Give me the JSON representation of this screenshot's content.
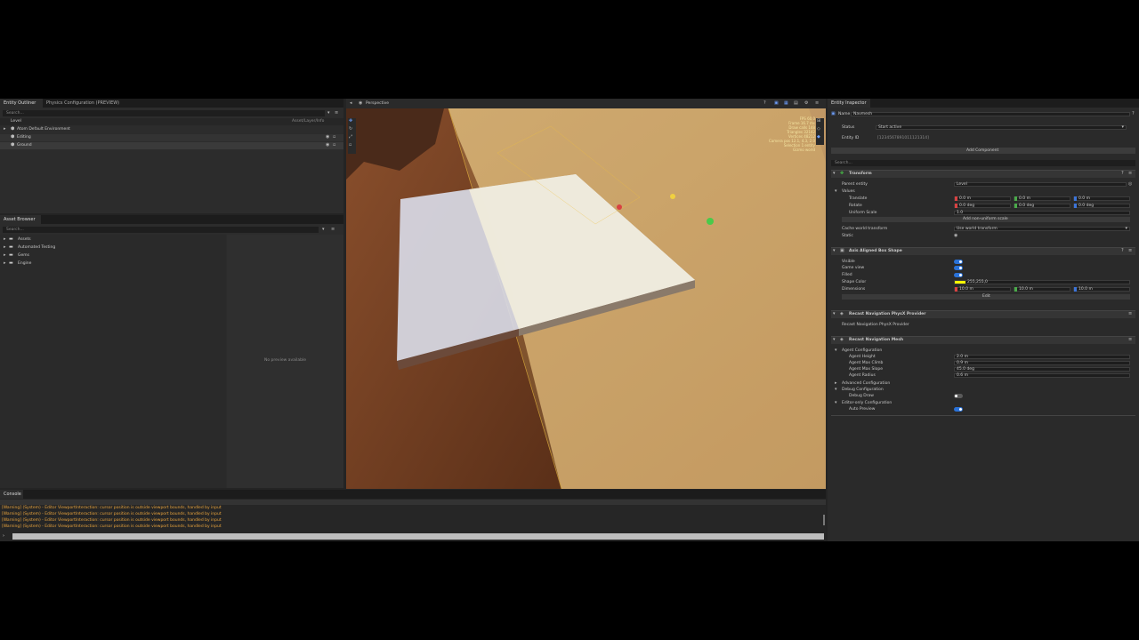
{
  "hierarchy": {
    "tabs": [
      "Entity Outliner",
      "Physics Configuration (PREVIEW)"
    ],
    "search_placeholder": "Search...",
    "column_label": "Level",
    "column_right": "Asset/Layer/Info",
    "items": [
      {
        "label": "Atom Default Environment"
      },
      {
        "label": "Editing"
      },
      {
        "label": "Ground"
      }
    ]
  },
  "asset_browser": {
    "tab": "Asset Browser",
    "search_placeholder": "Search...",
    "folders": [
      {
        "label": "Assets"
      },
      {
        "label": "Automated Testing"
      },
      {
        "label": "Gems"
      },
      {
        "label": "Engine"
      }
    ],
    "preview_text": "No preview available"
  },
  "viewport": {
    "tab": "Perspective",
    "stats": [
      "FPS 60.0",
      "Frame 16.7 ms",
      "Draw calls 148",
      "Triangles 32142",
      "Vertices 48212",
      "Camera pos 12.1, 4.3, 2.0",
      "Selection 1 entity",
      "Gizmo world"
    ]
  },
  "console": {
    "tab": "Console",
    "lines": [
      "[Warning] (System) - Editor ViewportInteraction: cursor position is outside viewport bounds, handled by input",
      "[Warning] (System) - Editor ViewportInteraction: cursor position is outside viewport bounds, handled by input",
      "[Warning] (System) - Editor ViewportInteraction: cursor position is outside viewport bounds, handled by input",
      "[Warning] (System) - Editor ViewportInteraction: cursor position is outside viewport bounds, handled by input"
    ]
  },
  "inspector": {
    "tab": "Entity Inspector",
    "name_label": "Name",
    "name_value": "Navmesh",
    "status_label": "Status",
    "status_value": "Start active",
    "entity_id_label": "Entity ID",
    "entity_id": "[1234567891011121314]",
    "add_component": "Add Component",
    "search_placeholder": "Search...",
    "transform": {
      "title": "Transform",
      "parent_label": "Parent entity",
      "parent_value": "Level",
      "values_label": "Values",
      "translate_label": "Translate",
      "rotate_label": "Rotate",
      "scale_label": "Uniform Scale",
      "translate": [
        "0.0 m",
        "0.0 m",
        "0.0 m"
      ],
      "rotate": [
        "0.0 deg",
        "0.0 deg",
        "0.0 deg"
      ],
      "scale": "1.0",
      "add_scale_btn": "Add non-uniform scale",
      "cache_label": "Cache world transform",
      "cache_value": "Use world transform",
      "static_label": "Static"
    },
    "box_shape": {
      "title": "Axis Aligned Box Shape",
      "visible": "Visible",
      "game_view": "Game view",
      "filled": "Filled",
      "color_label": "Shape Color",
      "color_value": "255,255,0",
      "dim_label": "Dimensions",
      "dims": [
        "10.0 m",
        "10.0 m",
        "10.0 m"
      ],
      "edit": "Edit"
    },
    "physx_provider": {
      "title": "Recast Navigation PhysX Provider",
      "text": "Recast Navigation PhysX Provider"
    },
    "navmesh": {
      "title": "Recast Navigation Mesh",
      "agent_config": "Agent Configuration",
      "agent_height": "Agent Height",
      "agent_climb": "Agent Max Climb",
      "agent_slope": "Agent Max Slope",
      "agent_radius": "Agent Radius",
      "values": [
        "2.0 m",
        "0.9 m",
        "45.0 deg",
        "0.6 m"
      ],
      "advanced": "Advanced Configuration",
      "debug": "Debug Configuration",
      "debug_draw": "Debug Draw",
      "editor_only": "Editor-only Configuration",
      "auto_preview": "Auto Preview"
    }
  },
  "colors": {
    "accent": "#2a72d8",
    "warning": "#e8a33d",
    "x": "#d84242",
    "y": "#4aaa4a",
    "z": "#3c74d8"
  }
}
